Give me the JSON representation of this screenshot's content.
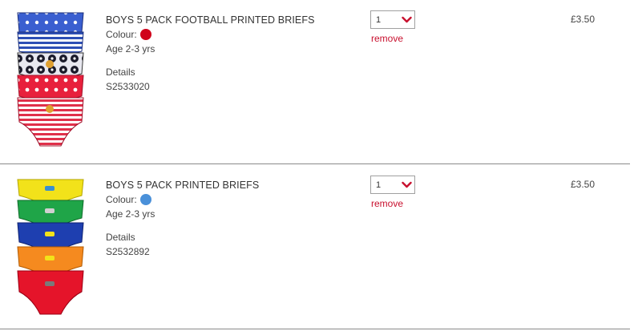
{
  "cart": {
    "items": [
      {
        "title": "BOYS 5 PACK FOOTBALL PRINTED BRIEFS",
        "colour_label": "Colour:",
        "colour_hex": "#d0021b",
        "age": "Age 2-3 yrs",
        "details_label": "Details",
        "sku": "S2533020",
        "quantity": "1",
        "remove_label": "remove",
        "price": "£3.50",
        "image_icon": "football-briefs-pack-image"
      },
      {
        "title": "BOYS 5 PACK PRINTED BRIEFS",
        "colour_label": "Colour:",
        "colour_hex": "#4a90d9",
        "age": "Age 2-3 yrs",
        "details_label": "Details",
        "sku": "S2532892",
        "quantity": "1",
        "remove_label": "remove",
        "price": "£3.50",
        "image_icon": "printed-briefs-pack-image"
      }
    ]
  },
  "colors": {
    "accent": "#c8102e",
    "divider": "#8a8a8a",
    "text": "#444444"
  }
}
